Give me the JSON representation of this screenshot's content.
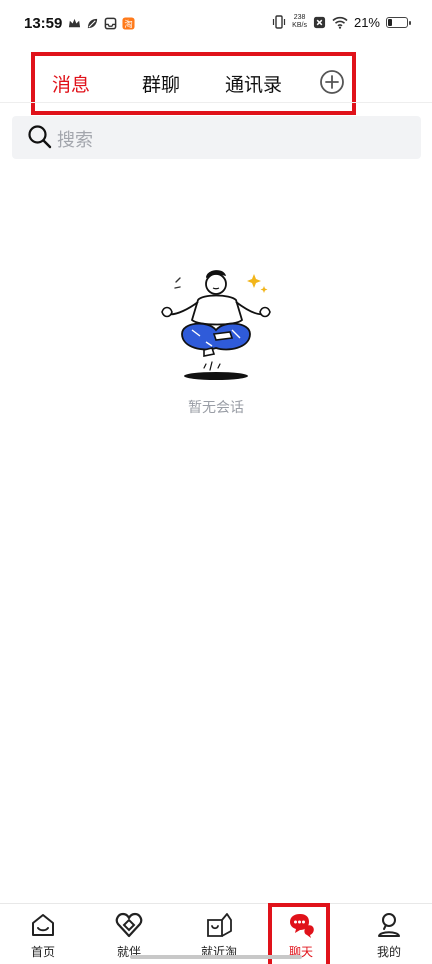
{
  "status_bar": {
    "time": "13:59",
    "left_icons": [
      "crown-icon",
      "leaf-icon",
      "inbox-icon",
      "taobao-app-icon"
    ],
    "net_speed_value": "238",
    "net_speed_unit": "KB/s",
    "battery_percent": "21%",
    "battery_level": 0.21
  },
  "header": {
    "tabs": [
      {
        "label": "消息",
        "active": true
      },
      {
        "label": "群聊",
        "active": false
      },
      {
        "label": "通讯录",
        "active": false
      }
    ],
    "add_icon": "plus-circle-icon",
    "accent_color": "#e0121a"
  },
  "search": {
    "placeholder": "搜索",
    "icon": "search-icon"
  },
  "empty_state": {
    "illustration": "meditating-person-illustration",
    "text": "暂无会话"
  },
  "bottom_nav": {
    "items": [
      {
        "label": "首页",
        "icon": "home-icon",
        "active": false
      },
      {
        "label": "就伴",
        "icon": "heart-link-icon",
        "active": false
      },
      {
        "label": "就近淘",
        "icon": "shop-bag-icon",
        "active": false
      },
      {
        "label": "聊天",
        "icon": "chat-bubbles-icon",
        "active": true
      },
      {
        "label": "我的",
        "icon": "user-icon",
        "active": false
      }
    ]
  }
}
